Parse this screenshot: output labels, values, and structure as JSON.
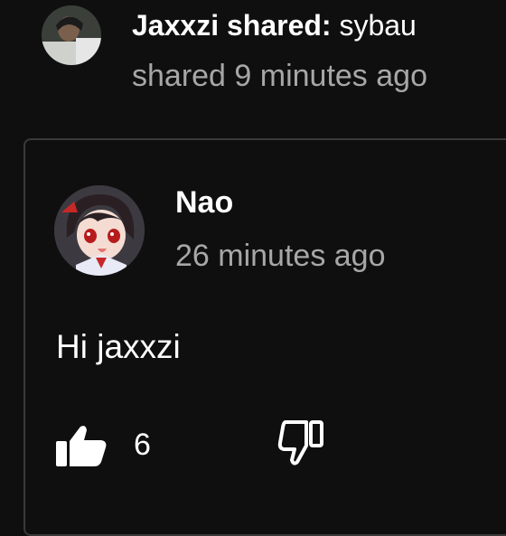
{
  "share": {
    "user": "Jaxxzi shared:",
    "text": "sybau",
    "time": "shared 9 minutes ago",
    "avatar_icon": "user-photo-avatar"
  },
  "post": {
    "author": "Nao",
    "time": "26 minutes ago",
    "message": "Hi jaxxzi",
    "avatar_icon": "anime-character-avatar",
    "likes": "6",
    "like_icon": "thumbs-up-icon",
    "dislike_icon": "thumbs-down-icon"
  },
  "colors": {
    "background": "#0f0f10",
    "primary_text": "#ffffff",
    "secondary_text": "#a7a7a7",
    "card_border": "#3a3a3a"
  }
}
